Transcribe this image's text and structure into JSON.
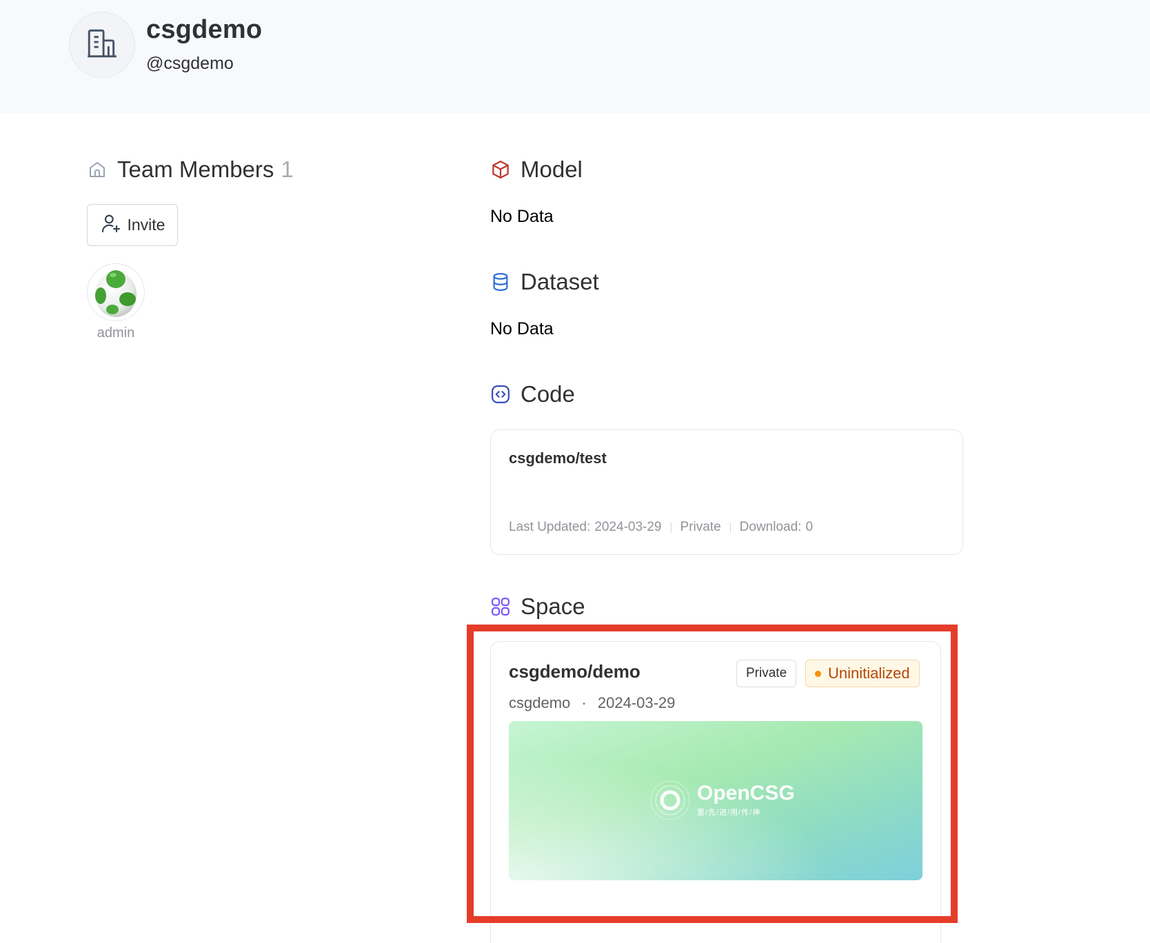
{
  "org": {
    "name": "csgdemo",
    "handle": "@csgdemo",
    "avatar_icon": "building-icon"
  },
  "members": {
    "title": "Team Members",
    "count": "1",
    "invite_label": "Invite",
    "list": [
      {
        "name": "admin",
        "avatar_icon": "green-egg-avatar"
      }
    ]
  },
  "sections": {
    "model": {
      "title": "Model",
      "empty": "No Data",
      "icon": "cube-icon",
      "color": "#c0392b"
    },
    "dataset": {
      "title": "Dataset",
      "empty": "No Data",
      "icon": "database-icon",
      "color": "#2f6fd6"
    },
    "code": {
      "title": "Code",
      "icon": "code-icon",
      "color": "#3b4fb8",
      "items": [
        {
          "repo": "csgdemo/test",
          "updated_label": "Last Updated:",
          "updated_value": "2024-03-29",
          "visibility": "Private",
          "download_label": "Download:",
          "download_value": "0"
        }
      ]
    },
    "space": {
      "title": "Space",
      "icon": "grid-icon",
      "color": "#7a5af8",
      "items": [
        {
          "repo": "csgdemo/demo",
          "owner": "csgdemo",
          "date": "2024-03-29",
          "visibility": "Private",
          "status": "Uninitialized",
          "cover": {
            "brand": "OpenCSG",
            "slogan": "要/先/进/用/传/神"
          }
        }
      ]
    }
  },
  "colors": {
    "highlight": "#e53d2a",
    "status_warning": "#f79009"
  }
}
